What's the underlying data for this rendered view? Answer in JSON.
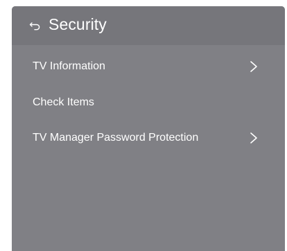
{
  "header": {
    "title": "Security",
    "back_icon": "back-arrow-icon"
  },
  "menu": {
    "items": [
      {
        "label": "TV Information",
        "has_chevron": true,
        "icon": "chevron-right-icon"
      },
      {
        "label": "Check Items",
        "has_chevron": false
      },
      {
        "label": "TV Manager Password Protection",
        "has_chevron": true,
        "icon": "chevron-right-icon"
      }
    ]
  },
  "colors": {
    "panel_background": "#808085",
    "header_background": "#76767b",
    "text": "#ffffff"
  }
}
